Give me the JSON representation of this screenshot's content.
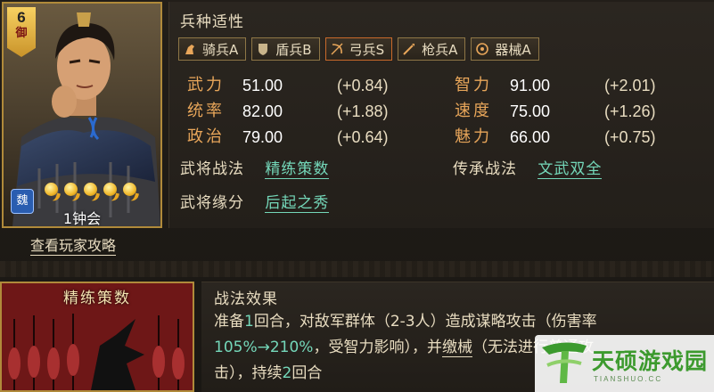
{
  "hero": {
    "star_level": "6",
    "troop_type": "御",
    "faction": "魏",
    "cost": 5,
    "name": "1钟会"
  },
  "guide_link": "查看玩家攻略",
  "affinity": {
    "title": "兵种适性",
    "items": [
      {
        "label": "骑兵A",
        "icon": "horse-icon",
        "selected": false
      },
      {
        "label": "盾兵B",
        "icon": "shield-icon",
        "selected": false
      },
      {
        "label": "弓兵S",
        "icon": "bow-icon",
        "selected": true
      },
      {
        "label": "枪兵A",
        "icon": "spear-icon",
        "selected": false
      },
      {
        "label": "器械A",
        "icon": "siege-icon",
        "selected": false
      }
    ]
  },
  "stats": [
    {
      "label": "武力",
      "value": "51.00",
      "bonus": "(+0.84)"
    },
    {
      "label": "统率",
      "value": "82.00",
      "bonus": "(+1.88)"
    },
    {
      "label": "政治",
      "value": "79.00",
      "bonus": "(+0.64)"
    },
    {
      "label": "智力",
      "value": "91.00",
      "bonus": "(+2.01)"
    },
    {
      "label": "速度",
      "value": "75.00",
      "bonus": "(+1.26)"
    },
    {
      "label": "魅力",
      "value": "66.00",
      "bonus": "(+0.75)"
    }
  ],
  "skills": {
    "own_label": "武将战法",
    "own_value": "精练策数",
    "inherit_label": "传承战法",
    "inherit_value": "文武双全",
    "bond_label": "武将缘分",
    "bond_value": "后起之秀"
  },
  "skill_card": {
    "title": "精练策数"
  },
  "effect": {
    "title": "战法效果",
    "t1": "准备",
    "t2": "1",
    "t3": "回合，对敌军群体（2-3人）造成谋略攻击（伤害率",
    "t4": "105%→210%",
    "t5": "，受智力影响），并",
    "t6": "缴械",
    "t7": "（无法进行普通攻",
    "t8": "击），持续",
    "t9": "2",
    "t10": "回合"
  },
  "watermark": {
    "text": "天硕游戏园",
    "sub": "TIANSHUO.CC"
  },
  "colors": {
    "gold_border": "#b08a3a",
    "stat_label": "#e8a65a",
    "link_teal": "#74d7b9",
    "bow_selected": "#c9692a"
  }
}
